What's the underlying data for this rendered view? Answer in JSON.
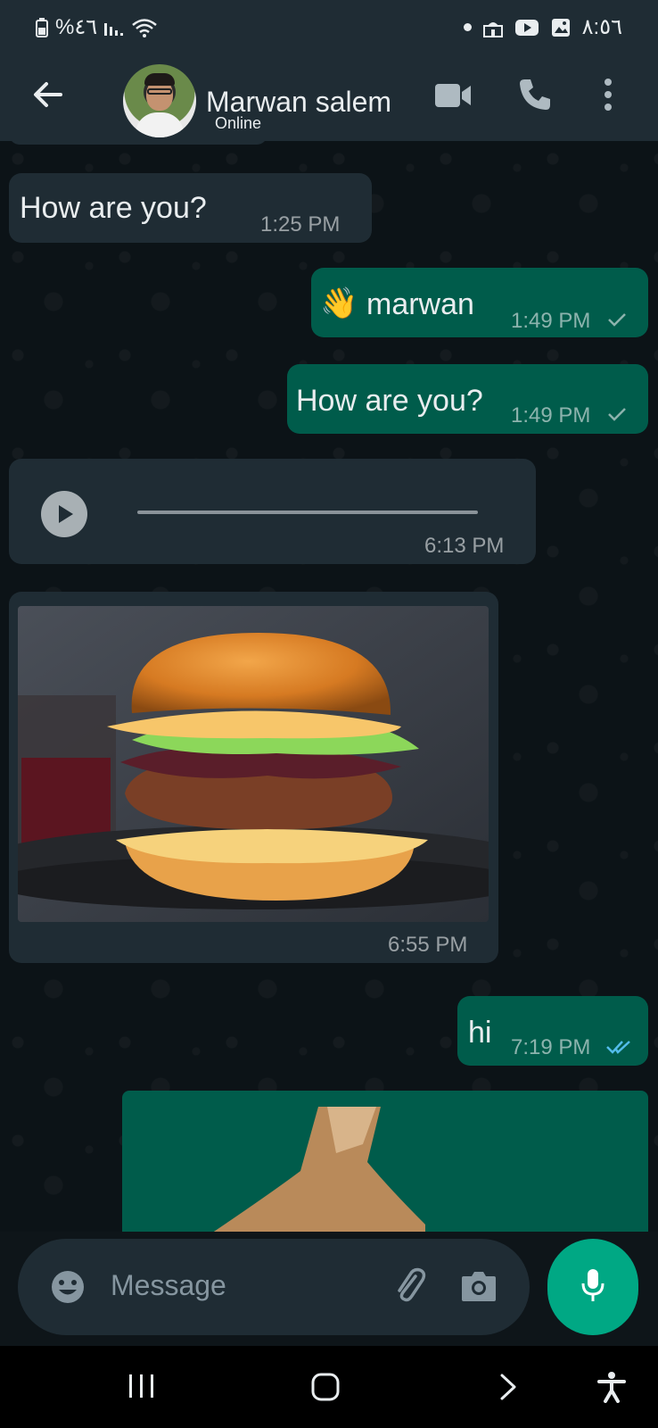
{
  "status_bar": {
    "battery_label": "%٤٦",
    "time": "٨:٥٦"
  },
  "header": {
    "contact_name": "Marwan salem",
    "contact_status": "Online"
  },
  "messages": [
    {
      "direction": "incoming",
      "type": "text",
      "text": "How are you?",
      "time": "1:25 PM"
    },
    {
      "direction": "outgoing",
      "type": "text",
      "emoji": "👋",
      "text": "marwan",
      "time": "1:49 PM",
      "status": "sent"
    },
    {
      "direction": "outgoing",
      "type": "text",
      "text": "How are you?",
      "time": "1:49 PM",
      "status": "sent"
    },
    {
      "direction": "incoming",
      "type": "voice",
      "time": "6:13 PM"
    },
    {
      "direction": "incoming",
      "type": "image",
      "image_desc": "burger",
      "time": "6:55 PM"
    },
    {
      "direction": "outgoing",
      "type": "text",
      "text": "hi",
      "time": "7:19 PM",
      "status": "read"
    },
    {
      "direction": "outgoing",
      "type": "sticker"
    }
  ],
  "input": {
    "placeholder": "Message"
  },
  "colors": {
    "header_bg": "#1f2c34",
    "incoming_bubble": "#1f2c34",
    "outgoing_bubble": "#005c4b",
    "accent": "#00a884",
    "read_tick": "#53bdeb"
  },
  "icons": {
    "header": [
      "back-arrow-icon",
      "video-call-icon",
      "phone-icon",
      "more-vert-icon"
    ],
    "input": [
      "emoji-icon",
      "attach-icon",
      "camera-icon",
      "mic-icon"
    ],
    "nav": [
      "recents-icon",
      "home-icon",
      "back-icon",
      "accessibility-icon"
    ]
  }
}
